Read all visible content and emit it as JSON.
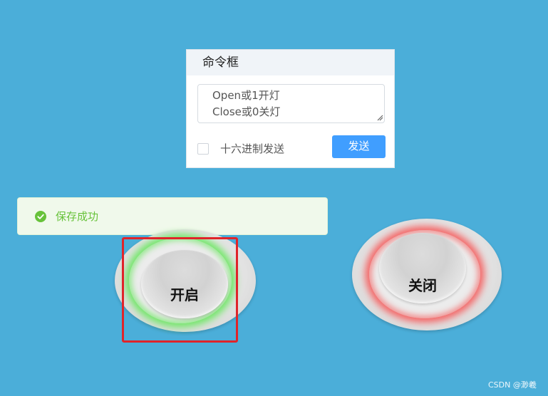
{
  "command_panel": {
    "title": "命令框",
    "textarea_value": "Open或1开灯\nClose或0关灯",
    "hex_checkbox_label": "十六进制发送",
    "hex_checked": false,
    "send_label": "发送"
  },
  "toast": {
    "message": "保存成功",
    "icon": "check-circle-icon",
    "color": "#67c23a"
  },
  "buttons": {
    "open_label": "开启",
    "close_label": "关闭",
    "open_glow_color": "#6ee664",
    "close_glow_color": "#f55a5a"
  },
  "highlight_color": "#e0242a",
  "background_color": "#4baed9",
  "watermark": "CSDN @渺羲"
}
